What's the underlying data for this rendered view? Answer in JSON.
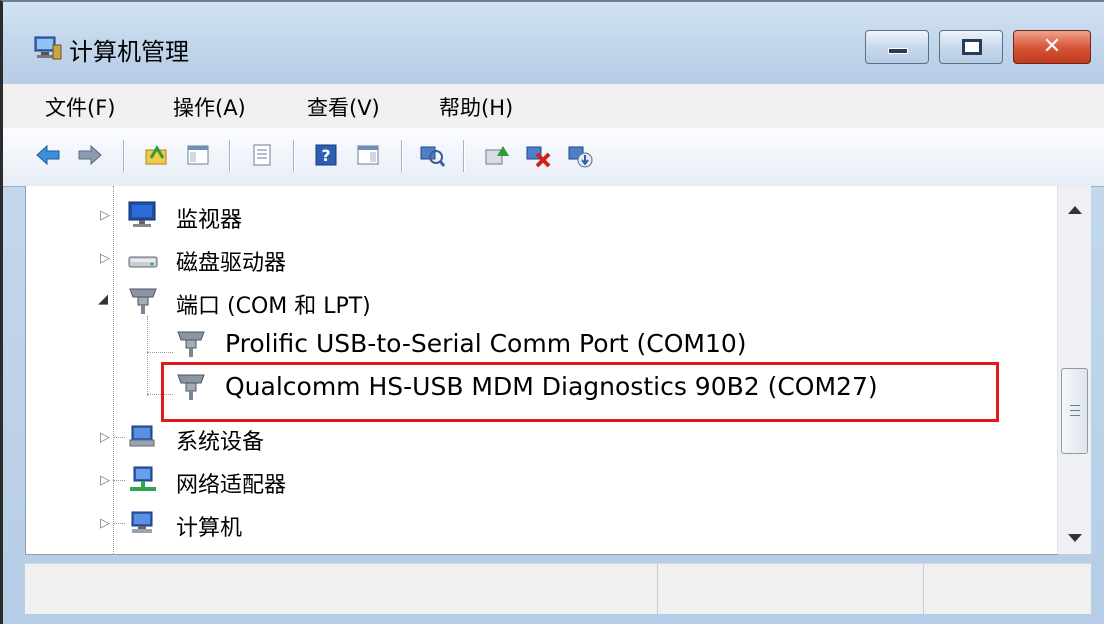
{
  "window": {
    "title": "计算机管理",
    "controls": {
      "minimize_icon": "minimize-icon",
      "maximize_icon": "maximize-icon",
      "close_icon": "close-icon",
      "close_glyph": "✕"
    }
  },
  "menu": {
    "items": [
      {
        "label": "文件(F)"
      },
      {
        "label": "操作(A)"
      },
      {
        "label": "查看(V)"
      },
      {
        "label": "帮助(H)"
      }
    ]
  },
  "toolbar": {
    "buttons": [
      "back-arrow-icon",
      "forward-arrow-icon",
      "up-folder-icon",
      "show-hide-tree-icon",
      "properties-icon",
      "help-icon",
      "show-action-pane-icon",
      "scan-hardware-icon",
      "update-driver-icon",
      "disable-device-icon",
      "uninstall-device-icon"
    ]
  },
  "tree": {
    "rows": [
      {
        "label": "监视器",
        "icon": "monitor-icon",
        "expander": "▷",
        "level": "category"
      },
      {
        "label": "磁盘驱动器",
        "icon": "disk-drive-icon",
        "expander": "▷",
        "level": "category"
      },
      {
        "label": "端口 (COM 和 LPT)",
        "icon": "port-icon",
        "expander": "◢",
        "level": "category",
        "expanded": true
      },
      {
        "label": "Prolific USB-to-Serial Comm Port (COM10)",
        "icon": "serial-port-icon",
        "level": "device"
      },
      {
        "label": "Qualcomm HS-USB MDM Diagnostics 90B2 (COM27)",
        "icon": "serial-port-icon",
        "level": "device",
        "highlighted": true
      },
      {
        "label": "系统设备",
        "icon": "system-device-icon",
        "expander": "▷",
        "level": "category"
      },
      {
        "label": "网络适配器",
        "icon": "network-adapter-icon",
        "expander": "▷",
        "level": "category"
      },
      {
        "label": "计算机",
        "icon": "computer-icon",
        "expander": "▷",
        "level": "category"
      }
    ]
  },
  "highlight": {
    "color": "#e01a1a",
    "target": "Qualcomm HS-USB MDM Diagnostics 90B2 (COM27)"
  },
  "colors": {
    "titlebar": "#bfd4ea",
    "close_button": "#c0391e",
    "menu_bg": "#f0f0f0"
  }
}
